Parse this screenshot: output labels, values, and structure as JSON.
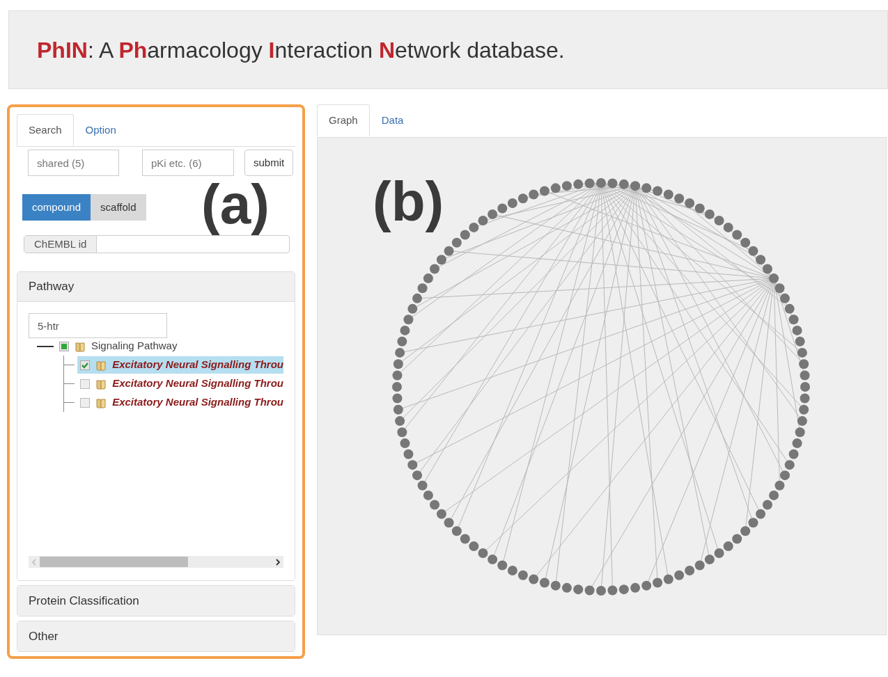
{
  "header": {
    "title": "**PhIN**: A **Ph**armacology **I**nteraction **N**etwork database."
  },
  "left_panel": {
    "tabs": [
      {
        "label": "Search",
        "selected": true
      },
      {
        "label": "Option",
        "selected": false
      }
    ],
    "fields": [
      {
        "placeholder": "shared (5)"
      },
      {
        "placeholder": "pKi etc. (6)"
      }
    ],
    "submit": "submit",
    "toggle": [
      {
        "label": "compound",
        "selected": true
      },
      {
        "label": "scaffold",
        "selected": false
      }
    ],
    "id_field": {
      "addon": "ChEMBL id"
    },
    "annotation": "(a)",
    "sections": [
      {
        "title": "Pathway",
        "expanded": true
      },
      {
        "title": "Protein Classification",
        "expanded": false
      },
      {
        "title": "Other",
        "expanded": false
      }
    ],
    "filter": {
      "value": "5-htr"
    },
    "tree": [
      {
        "label": "Signaling Pathway",
        "checked": false,
        "partial": true,
        "selected": false,
        "children": [
          {
            "label": "Excitatory Neural Signalling Throu",
            "checked": true,
            "selected": true
          },
          {
            "label": "Excitatory Neural Signalling Throu",
            "checked": false,
            "selected": false
          },
          {
            "label": "Excitatory Neural Signalling Throu",
            "checked": false,
            "selected": false
          }
        ]
      }
    ]
  },
  "right_panel": {
    "tabs": [
      {
        "label": "Graph",
        "selected": true
      },
      {
        "label": "Data",
        "selected": false
      }
    ],
    "annotation": "(b)"
  }
}
